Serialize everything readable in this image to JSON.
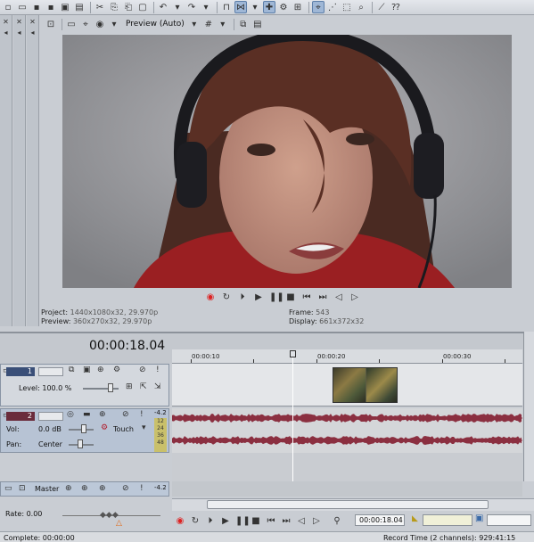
{
  "preview": {
    "mode": "Preview (Auto)"
  },
  "info": {
    "project_label": "Project:",
    "project_value": "1440x1080x32, 29.970p",
    "preview_label": "Preview:",
    "preview_value": "360x270x32, 29.970p",
    "frame_label": "Frame:",
    "frame_value": "543",
    "display_label": "Display:",
    "display_value": "661x372x32"
  },
  "timeline": {
    "timecode": "00:00:18.04",
    "ruler": [
      "00:00:10",
      "00:00:20",
      "00:00:30"
    ]
  },
  "video_track": {
    "number": "1",
    "level_label": "Level: 100.0 %"
  },
  "audio_track": {
    "number": "2",
    "vol_label": "Vol:",
    "vol_value": "0.0 dB",
    "pan_label": "Pan:",
    "pan_value": "Center",
    "automation": "Touch",
    "meter_top": "-4.2",
    "meter_scale": [
      "12",
      "24",
      "36",
      "48"
    ]
  },
  "master": {
    "label": "Master",
    "meter": "-4.2"
  },
  "rate": {
    "label": "Rate: 0.00"
  },
  "transport": {
    "timecode": "00:00:18.04"
  },
  "status": {
    "left": "Complete: 00:00:00",
    "right": "Record Time (2 channels): 929:41:15"
  },
  "colors": {
    "track_video": "#3a4f78",
    "track_audio": "#6a2c3c",
    "waveform": "#8b2f40",
    "record": "#dd2222"
  }
}
